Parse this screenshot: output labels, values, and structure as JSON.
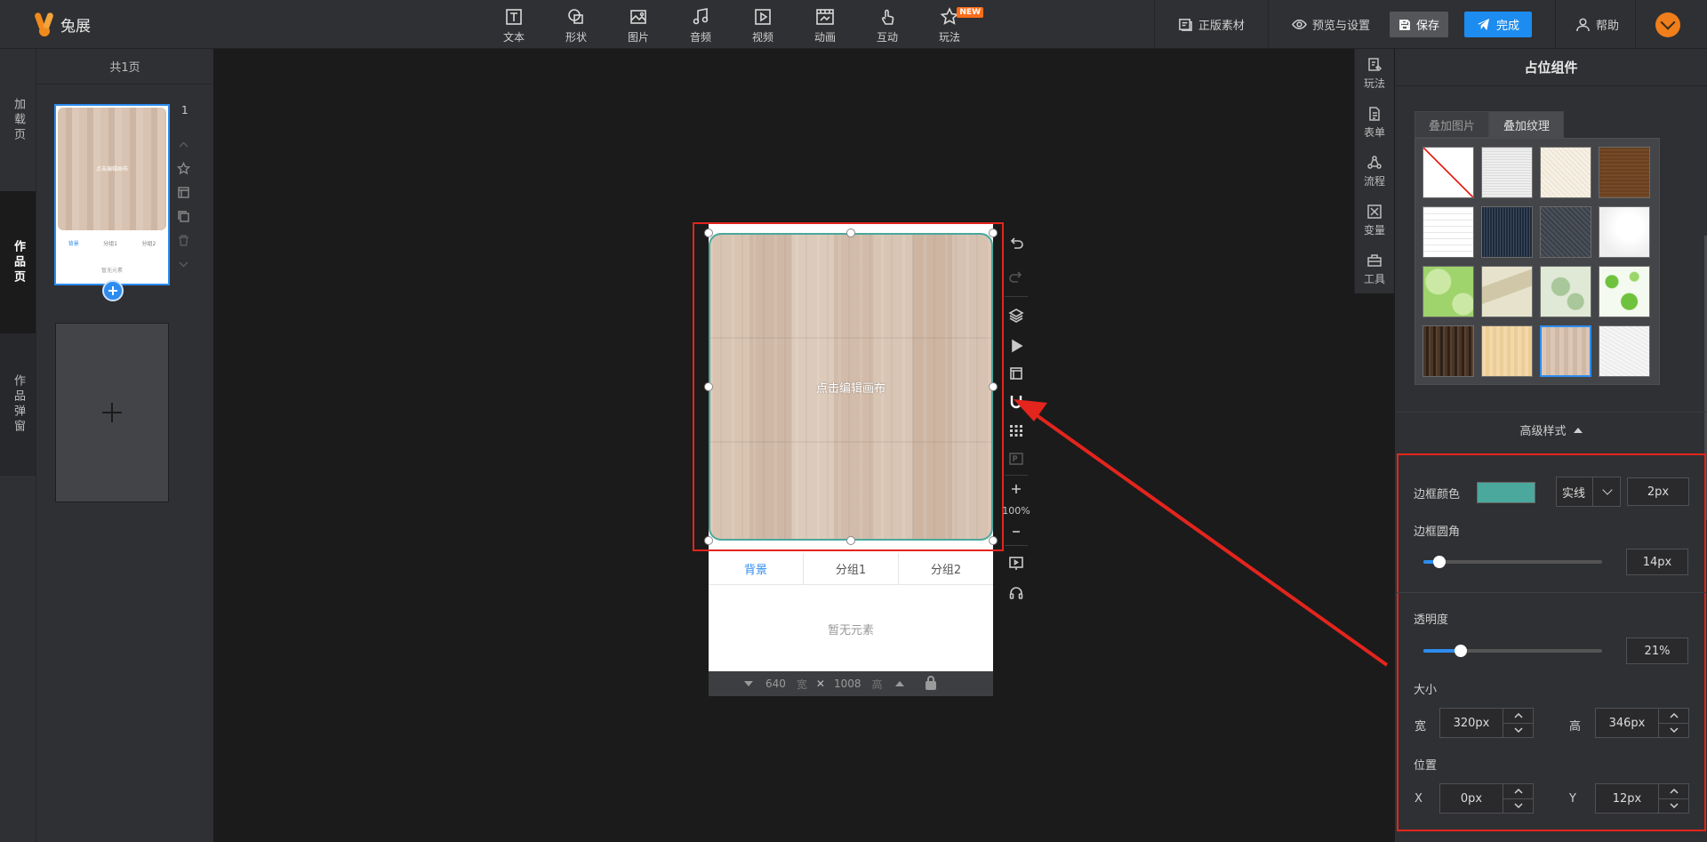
{
  "app": {
    "name": "兔展"
  },
  "toolbar": {
    "tools": [
      {
        "label": "文本",
        "icon": "text-icon"
      },
      {
        "label": "形状",
        "icon": "shape-icon"
      },
      {
        "label": "图片",
        "icon": "image-icon"
      },
      {
        "label": "音频",
        "icon": "audio-icon"
      },
      {
        "label": "视频",
        "icon": "video-icon"
      },
      {
        "label": "动画",
        "icon": "animation-icon"
      },
      {
        "label": "互动",
        "icon": "interaction-icon"
      },
      {
        "label": "玩法",
        "icon": "gameplay-icon",
        "badge": "NEW"
      }
    ],
    "copyright": "正版素材",
    "preview": "预览与设置",
    "save": "保存",
    "done": "完成",
    "help": "帮助"
  },
  "left_tabs": [
    "加载页",
    "作品页",
    "作品弹窗"
  ],
  "pages": {
    "header": "共1页",
    "page_number": "1",
    "thumb_hint": "点击编辑画布",
    "thumb_tabs": [
      "背景",
      "分组1",
      "分组2"
    ],
    "thumb_empty": "暂无元素"
  },
  "canvas": {
    "hint": "点击编辑画布",
    "tabs": [
      "背景",
      "分组1",
      "分组2"
    ],
    "empty": "暂无元素",
    "width": "640",
    "width_unit": "宽",
    "height": "1008",
    "height_unit": "高",
    "zoom": "100%"
  },
  "right_side": [
    "玩法",
    "表单",
    "流程",
    "变量",
    "工具"
  ],
  "panel": {
    "title": "占位组件",
    "texture_tabs": [
      "叠加图片",
      "叠加纹理"
    ],
    "active_texture_tab": 1,
    "selected_texture": 14,
    "advanced": "高级样式",
    "border_color_label": "边框颜色",
    "border_color": "#4aa89c",
    "border_style": "实线",
    "border_width": "2px",
    "radius_label": "边框圆角",
    "radius_value": "14px",
    "radius_fraction": 0.09,
    "opacity_label": "透明度",
    "opacity_value": "21%",
    "opacity_fraction": 0.21,
    "size_label": "大小",
    "width_label": "宽",
    "width_value": "320px",
    "height_label": "高",
    "height_value": "346px",
    "position_label": "位置",
    "x_label": "X",
    "x_value": "0px",
    "y_label": "Y",
    "y_value": "12px"
  },
  "colors": {
    "accent": "#2d8cf0",
    "highlight": "#e3251d",
    "brand": "#f08a1c"
  }
}
